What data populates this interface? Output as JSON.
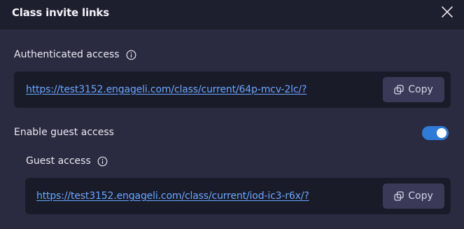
{
  "dialog": {
    "title": "Class invite links"
  },
  "authenticated": {
    "label": "Authenticated access",
    "url": "https://test3152.engageli.com/class/current/64p-mcv-2lc/?",
    "copy_label": "Copy"
  },
  "guest_toggle": {
    "label": "Enable guest access",
    "enabled": true
  },
  "guest": {
    "label": "Guest access",
    "url": "https://test3152.engageli.com/class/current/iod-ic3-r6x/?",
    "copy_label": "Copy"
  },
  "colors": {
    "accent": "#2f7bd6",
    "link": "#6aa6ff",
    "header_bg": "#1d1e2e",
    "body_bg": "#2a2b40"
  },
  "icons": [
    "close-icon",
    "info-icon",
    "copy-icon"
  ]
}
